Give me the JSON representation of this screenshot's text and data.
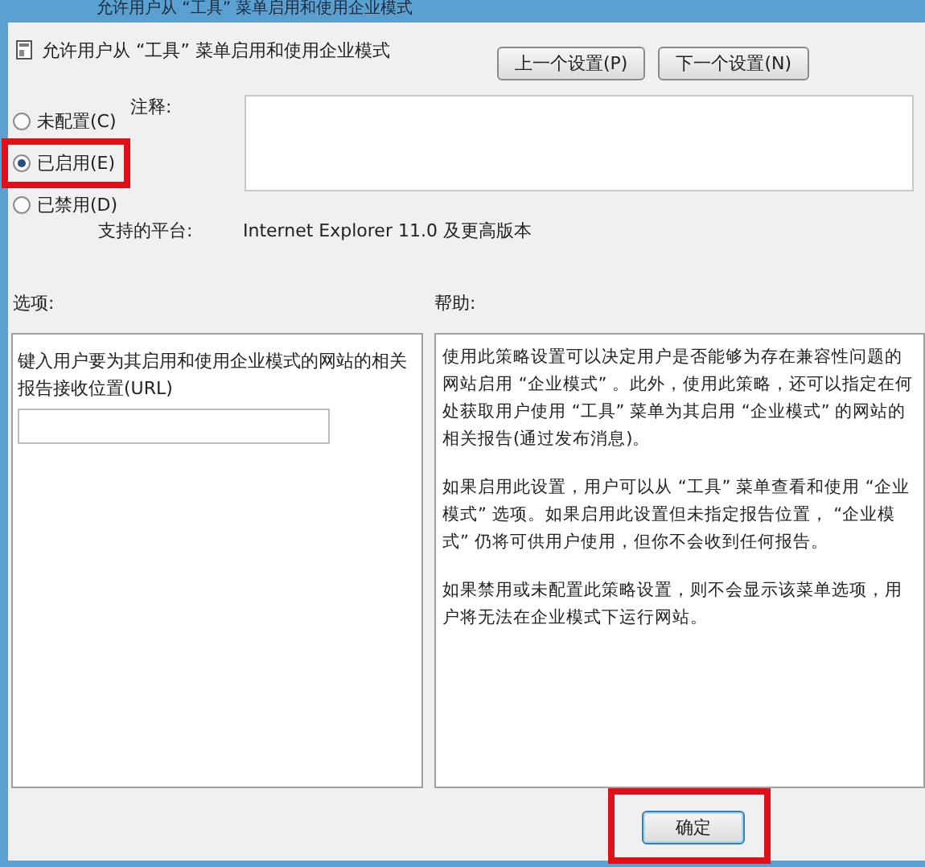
{
  "window": {
    "title": "允许用户从 “工具” 菜单启用和使用企业模式"
  },
  "header": {
    "title": "允许用户从 “工具” 菜单启用和使用企业模式"
  },
  "nav_buttons": [
    {
      "label": "上一个设置(P)"
    },
    {
      "label": "下一个设置(N)"
    }
  ],
  "states": [
    {
      "label": "未配置(C)",
      "selected": false,
      "highlighted": false
    },
    {
      "label": "已启用(E)",
      "selected": true,
      "highlighted": true
    },
    {
      "label": "已禁用(D)",
      "selected": false,
      "highlighted": false
    }
  ],
  "comment": {
    "label": "注释:"
  },
  "platform": {
    "label": "支持的平台:",
    "value": "Internet Explorer 11.0 及更高版本"
  },
  "options": {
    "label": "选项:",
    "prompt": "键入用户要为其启用和使用企业模式的网站的相关报告接收位置(URL)"
  },
  "help": {
    "label": "帮助:",
    "paragraphs": [
      "使用此策略设置可以决定用户是否能够为存在兼容性问题的网站启用 “企业模式” 。此外，使用此策略，还可以指定在何处获取用户使用 “工具” 菜单为其启用 “企业模式” 的网站的相关报告(通过发布消息)。",
      "如果启用此设置，用户可以从 “工具” 菜单查看和使用 “企业模式” 选项。如果启用此设置但未指定报告位置， “企业模式” 仍将可供用户使用，但你不会收到任何报告。",
      "如果禁用或未配置此策略设置，则不会显示该菜单选项，用户将无法在企业模式下运行网站。"
    ]
  },
  "ok_button": {
    "label": "确定",
    "highlighted": true
  }
}
